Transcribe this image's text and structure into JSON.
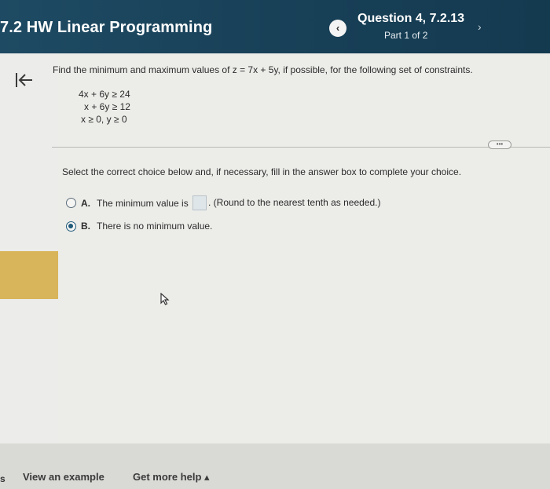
{
  "header": {
    "assignment_title": "7.2 HW Linear Programming",
    "question_title": "Question 4, 7.2.13",
    "part": "Part 1 of 2",
    "prev_glyph": "‹",
    "next_glyph": "›"
  },
  "question": {
    "prompt": "Find the minimum and maximum values of z = 7x + 5y, if possible, for the following set of constraints.",
    "constraints": [
      "4x + 6y ≥ 24",
      "x + 6y ≥ 12",
      "x ≥ 0, y ≥ 0"
    ]
  },
  "answer": {
    "instruction": "Select the correct choice below and, if necessary, fill in the answer box to complete your choice.",
    "choices": [
      {
        "letter": "A.",
        "text_before": "The minimum value is",
        "text_after": ". (Round to the nearest tenth as needed.)",
        "selected": false
      },
      {
        "letter": "B.",
        "text": "There is no minimum value.",
        "selected": true
      }
    ],
    "answer_box_value": ""
  },
  "footer": {
    "left_mark": "s",
    "view_example": "View an example",
    "get_help": "Get more help ▴"
  },
  "icons": {
    "collapse": "collapse-left-icon",
    "more": "more-options-icon",
    "cursor": "mouse-cursor-icon"
  },
  "colors": {
    "header_bg": "#1e4a63",
    "accent_yellow": "#d8b45a",
    "radio_selected": "#1f5a7a"
  }
}
